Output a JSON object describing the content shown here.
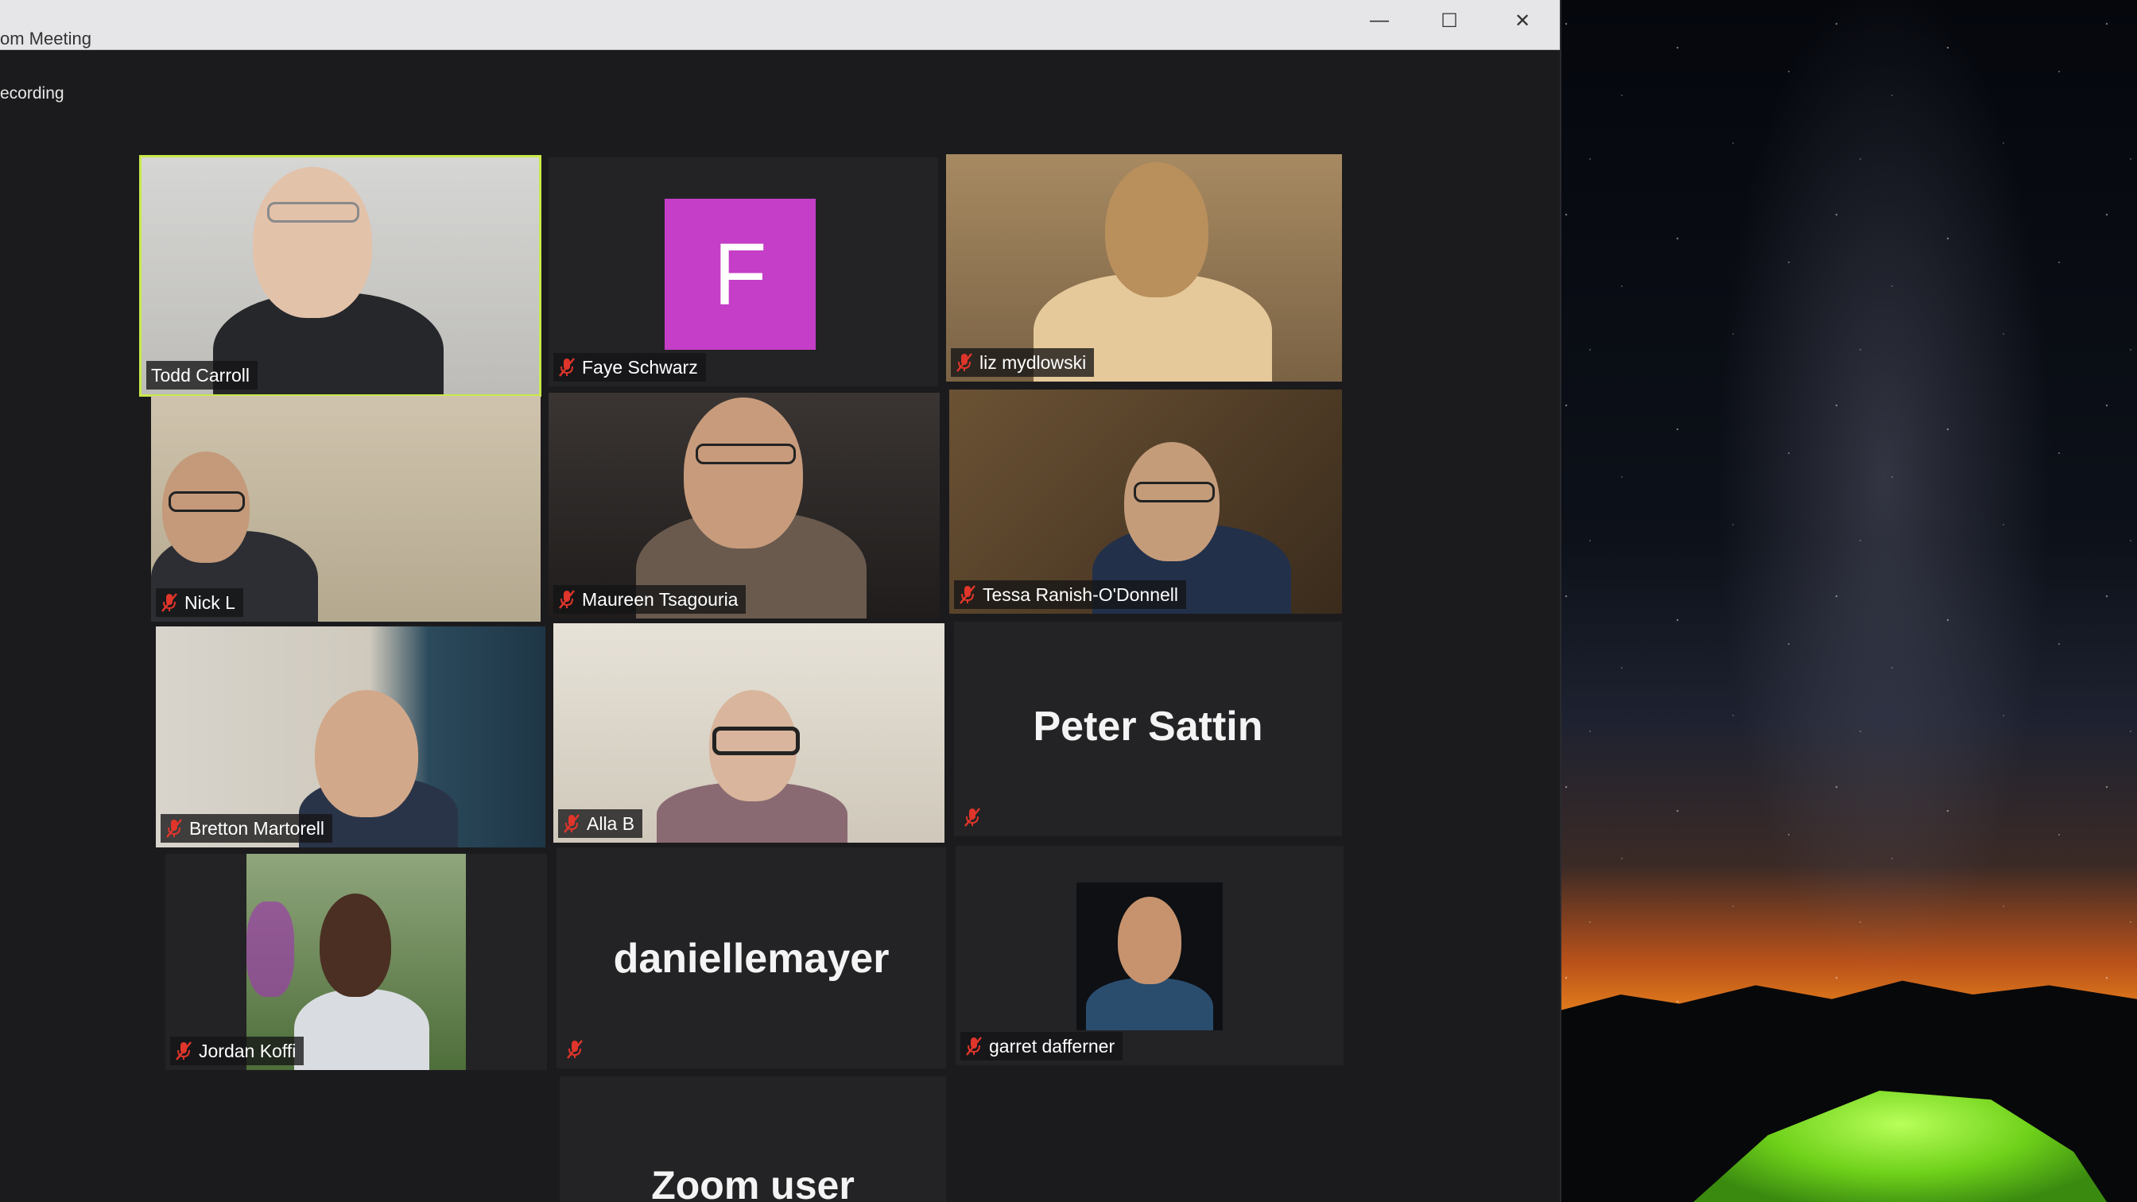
{
  "window": {
    "title": "om Meeting",
    "recording_label": "ecording",
    "controls": {
      "minimize": "—",
      "maximize": "☐",
      "close": "✕"
    }
  },
  "participants": [
    {
      "name": "Todd Carroll",
      "muted": false,
      "active_speaker": true,
      "view": "video"
    },
    {
      "name": "Faye Schwarz",
      "muted": true,
      "view": "avatar",
      "avatar_letter": "F",
      "avatar_color": "#c43ec7"
    },
    {
      "name": "liz mydlowski",
      "muted": true,
      "view": "video"
    },
    {
      "name": "Nick L",
      "muted": true,
      "view": "video"
    },
    {
      "name": "Maureen Tsagouria",
      "muted": true,
      "view": "video"
    },
    {
      "name": "Tessa Ranish-O'Donnell",
      "muted": true,
      "view": "video"
    },
    {
      "name": "Bretton Martorell",
      "muted": true,
      "view": "video"
    },
    {
      "name": "Alla B",
      "muted": true,
      "view": "video"
    },
    {
      "name": "Peter Sattin",
      "muted": true,
      "view": "name-only"
    },
    {
      "name": "Jordan Koffi",
      "muted": true,
      "view": "video"
    },
    {
      "name": "daniellemayer",
      "muted": true,
      "view": "name-only"
    },
    {
      "name": "garret dafferner",
      "muted": true,
      "view": "profile-photo"
    },
    {
      "name": "Zoom user",
      "muted": false,
      "view": "name-only"
    }
  ],
  "colors": {
    "active_speaker_border": "#c9e94a",
    "muted_icon": "#e0352b",
    "tile_background": "#232325"
  }
}
